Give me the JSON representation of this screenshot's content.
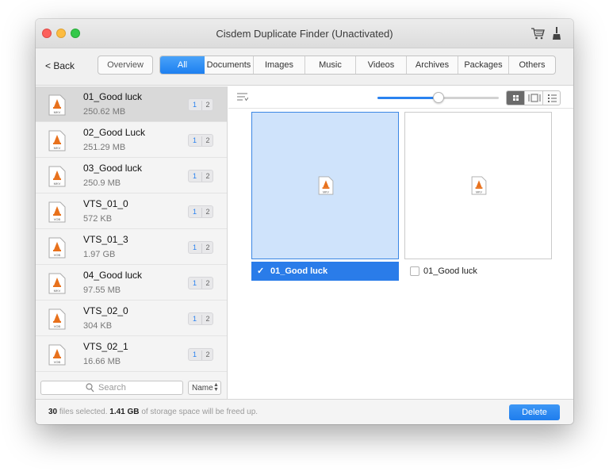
{
  "window": {
    "title": "Cisdem Duplicate Finder (Unactivated)"
  },
  "toolbar": {
    "back_label": "< Back",
    "overview_label": "Overview",
    "tabs": [
      {
        "label": "All"
      },
      {
        "label": "Documents"
      },
      {
        "label": "Images"
      },
      {
        "label": "Music"
      },
      {
        "label": "Videos"
      },
      {
        "label": "Archives"
      },
      {
        "label": "Packages"
      },
      {
        "label": "Others"
      }
    ],
    "active_tab": "All"
  },
  "files": [
    {
      "name": "01_Good luck",
      "size": "250.62 MB",
      "type": "MKV",
      "counts": [
        "1",
        "2"
      ]
    },
    {
      "name": "02_Good Luck",
      "size": "251.29 MB",
      "type": "MKV",
      "counts": [
        "1",
        "2"
      ]
    },
    {
      "name": "03_Good luck",
      "size": "250.9 MB",
      "type": "MKV",
      "counts": [
        "1",
        "2"
      ]
    },
    {
      "name": "VTS_01_0",
      "size": "572 KB",
      "type": "VOB",
      "counts": [
        "1",
        "2"
      ]
    },
    {
      "name": "VTS_01_3",
      "size": "1.97 GB",
      "type": "VOB",
      "counts": [
        "1",
        "2"
      ]
    },
    {
      "name": "04_Good luck",
      "size": "97.55 MB",
      "type": "MKV",
      "counts": [
        "1",
        "2"
      ]
    },
    {
      "name": "VTS_02_0",
      "size": "304 KB",
      "type": "VOB",
      "counts": [
        "1",
        "2"
      ]
    },
    {
      "name": "VTS_02_1",
      "size": "16.66 MB",
      "type": "VOB",
      "counts": [
        "1",
        "2"
      ]
    }
  ],
  "search": {
    "placeholder": "Search"
  },
  "sort": {
    "label": "Name"
  },
  "preview": {
    "zoom_fraction": 0.5,
    "cards": [
      {
        "name": "01_Good luck",
        "checked": true,
        "type": "MKV"
      },
      {
        "name": "01_Good luck",
        "checked": false,
        "type": "MKV"
      }
    ],
    "check_mark": "✓"
  },
  "status": {
    "count": "30",
    "text1": "files selected.",
    "size": "1.41 GB",
    "text2": "of storage space will be freed up."
  },
  "delete_label": "Delete",
  "colors": {
    "accent": "#2a82f0",
    "selected_bg": "#cfe3fb",
    "file_icon": "#e8711c"
  }
}
